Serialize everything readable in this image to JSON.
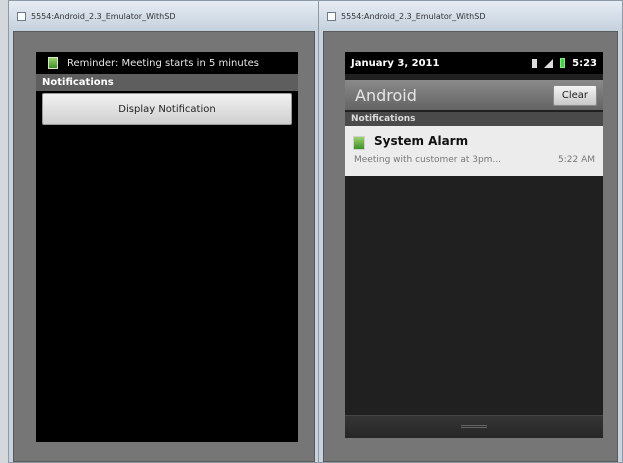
{
  "left_window": {
    "title": "5554:Android_2.3_Emulator_WithSD",
    "status_message": "Reminder: Meeting starts in 5 minutes",
    "app_title": "Notifications",
    "button_label": "Display Notification"
  },
  "right_window": {
    "title": "5554:Android_2.3_Emulator_WithSD",
    "date": "January 3, 2011",
    "time": "5:23",
    "header_title": "Android",
    "clear_label": "Clear",
    "section_label": "Notifications",
    "notification": {
      "title": "System Alarm",
      "text": "Meeting with customer at 3pm...",
      "time": "5:22 AM"
    }
  },
  "icons": [
    "app-icon",
    "notification-icon",
    "sd-card-icon",
    "signal-icon",
    "battery-icon",
    "alarm-icon"
  ]
}
